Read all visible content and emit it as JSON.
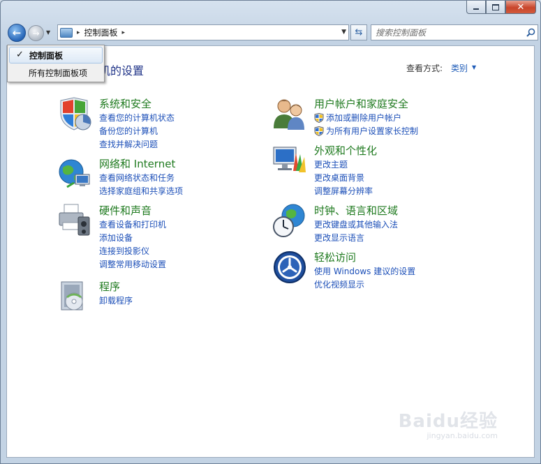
{
  "window": {
    "caption_close": "✕"
  },
  "nav": {
    "breadcrumb_root_sep": "▸",
    "breadcrumb": "控制面板",
    "breadcrumb_sep": "▸",
    "search_placeholder": "搜索控制面板"
  },
  "header": {
    "title": "机的设置",
    "view_label": "查看方式:",
    "view_value": "类别"
  },
  "dropdown": {
    "items": [
      {
        "label": "控制面板",
        "checked": true
      },
      {
        "label": "所有控制面板项",
        "checked": false
      }
    ]
  },
  "categories": {
    "system": {
      "title": "系统和安全",
      "links": [
        "查看您的计算机状态",
        "备份您的计算机",
        "查找并解决问题"
      ]
    },
    "network": {
      "title": "网络和 Internet",
      "links": [
        "查看网络状态和任务",
        "选择家庭组和共享选项"
      ]
    },
    "hardware": {
      "title": "硬件和声音",
      "links": [
        "查看设备和打印机",
        "添加设备",
        "连接到投影仪",
        "调整常用移动设置"
      ]
    },
    "programs": {
      "title": "程序",
      "links": [
        "卸载程序"
      ]
    },
    "users": {
      "title": "用户帐户和家庭安全",
      "links": [
        "添加或删除用户帐户",
        "为所有用户设置家长控制"
      ]
    },
    "appearance": {
      "title": "外观和个性化",
      "links": [
        "更改主题",
        "更改桌面背景",
        "调整屏幕分辨率"
      ]
    },
    "clock": {
      "title": "时钟、语言和区域",
      "links": [
        "更改键盘或其他输入法",
        "更改显示语言"
      ]
    },
    "ease": {
      "title": "轻松访问",
      "links": [
        "使用 Windows 建议的设置",
        "优化视频显示"
      ]
    }
  },
  "watermark": {
    "logo": "Baidu经验",
    "url": "jingyan.baidu.com"
  },
  "colors": {
    "category_title": "#1f7a1f",
    "link": "#1c4fb8",
    "page_title": "#1e3287"
  }
}
